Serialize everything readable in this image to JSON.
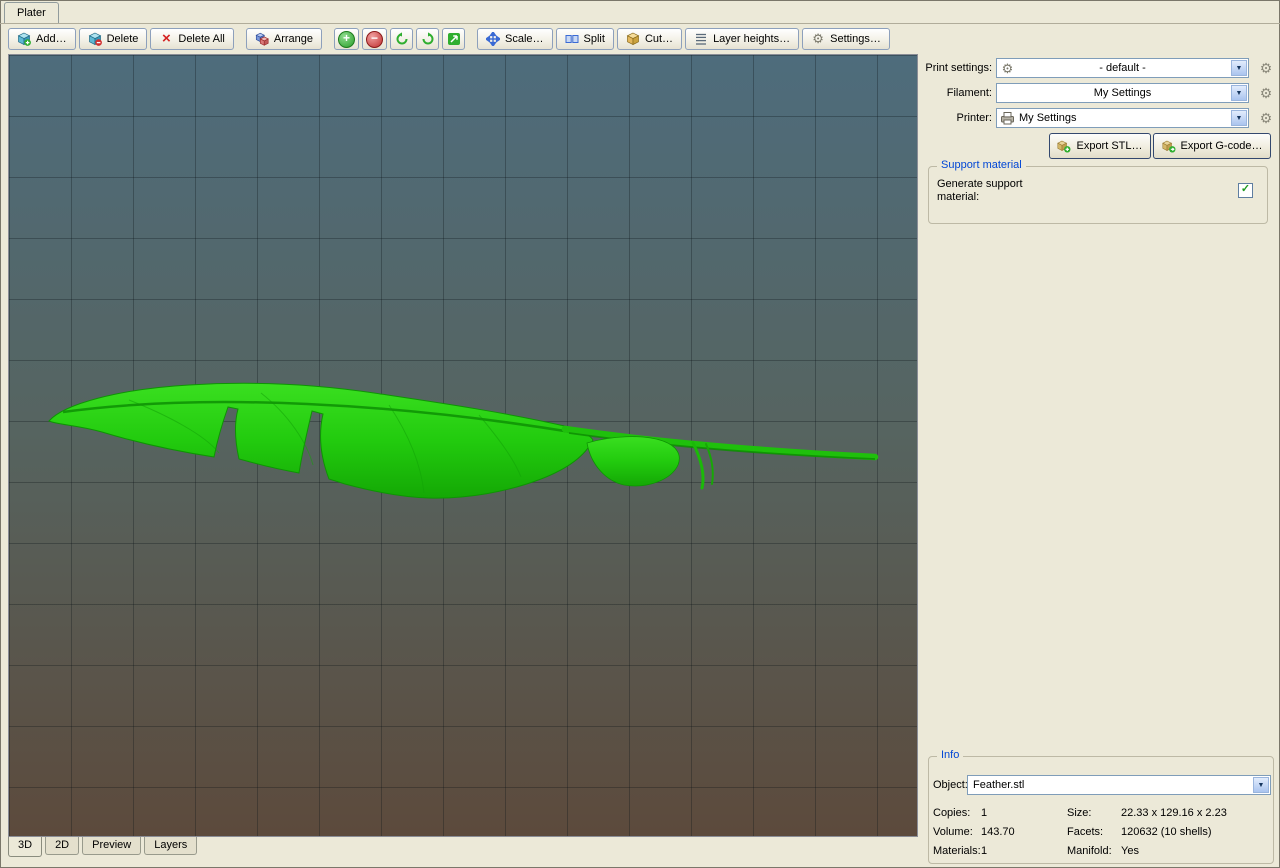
{
  "window": {
    "tab_label": "Plater"
  },
  "toolbar": {
    "add": "Add…",
    "delete": "Delete",
    "delete_all": "Delete All",
    "arrange": "Arrange",
    "scale": "Scale…",
    "split": "Split",
    "cut": "Cut…",
    "layer_heights": "Layer heights…",
    "settings": "Settings…"
  },
  "glyphs": {
    "plus": "+",
    "minus": "−",
    "combo_arrow": "▼",
    "check": "✓",
    "gear": "⚙",
    "delete_all_x": "×"
  },
  "right_panel": {
    "print_settings_label": "Print settings:",
    "print_settings_value": "- default -",
    "filament_label": "Filament:",
    "filament_value": "My Settings",
    "printer_label": "Printer:",
    "printer_value": "My Settings",
    "export_stl": "Export STL…",
    "export_gcode": "Export G-code…"
  },
  "support": {
    "title": "Support material",
    "generate_label": "Generate support material:"
  },
  "info": {
    "title": "Info",
    "object_label": "Object:",
    "object_value": "Feather.stl",
    "rows": [
      {
        "l1": "Copies:",
        "v1": "1",
        "l2": "Size:",
        "v2": "22.33 x 129.16 x 2.23"
      },
      {
        "l1": "Volume:",
        "v1": "143.70",
        "l2": "Facets:",
        "v2": "120632 (10 shells)"
      },
      {
        "l1": "Materials:",
        "v1": "1",
        "l2": "Manifold:",
        "v2": "Yes"
      }
    ]
  },
  "view_tabs": [
    "3D",
    "2D",
    "Preview",
    "Layers"
  ],
  "scene": {
    "object_color": "#22cb0e",
    "bed_top_color": "#4e6c7c",
    "bed_bottom_color": "#5c4a3c"
  }
}
